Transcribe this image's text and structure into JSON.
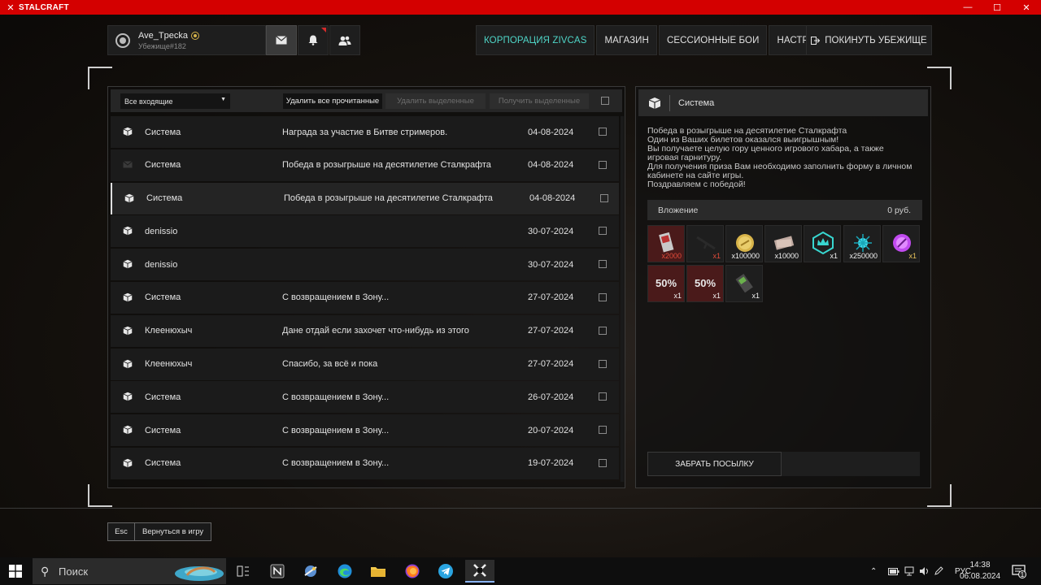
{
  "window": {
    "title": "STALCRAFT"
  },
  "profile": {
    "username": "Ave_Tpecka",
    "shelter": "Убежище#182"
  },
  "nav": {
    "items": [
      "КОРПОРАЦИЯ ZIVCAS",
      "МАГАЗИН",
      "СЕССИОННЫЕ БОИ",
      "НАСТРОЙКИ"
    ],
    "leave": "ПОКИНУТЬ УБЕЖИЩЕ"
  },
  "toolbar": {
    "filter": "Все входящие",
    "delete_read": "Удалить все прочитанные",
    "delete_selected": "Удалить выделенные",
    "get_selected": "Получить выделенные"
  },
  "messages": [
    {
      "sender": "Система",
      "subject": "Награда за участие в Битве стримеров.",
      "date": "04-08-2024",
      "icon": "box-icon"
    },
    {
      "sender": "Система",
      "subject": "Победа в розыгрыше на десятилетие Сталкрафта",
      "date": "04-08-2024",
      "icon": "envelope-icon"
    },
    {
      "sender": "Система",
      "subject": "Победа в розыгрыше на десятилетие Сталкрафта",
      "date": "04-08-2024",
      "icon": "box-icon",
      "selected": true
    },
    {
      "sender": "denissio",
      "subject": "",
      "date": "30-07-2024",
      "icon": "box-icon"
    },
    {
      "sender": "denissio",
      "subject": "",
      "date": "30-07-2024",
      "icon": "box-icon"
    },
    {
      "sender": "Система",
      "subject": "С возвращением в Зону...",
      "date": "27-07-2024",
      "icon": "box-icon"
    },
    {
      "sender": "Клеенюхыч",
      "subject": "Дане отдай если захочет что-нибудь из этого",
      "date": "27-07-2024",
      "icon": "box-icon"
    },
    {
      "sender": "Клеенюхыч",
      "subject": "Спасибо, за всё и пока",
      "date": "27-07-2024",
      "icon": "box-icon"
    },
    {
      "sender": "Система",
      "subject": "С возвращением в Зону...",
      "date": "26-07-2024",
      "icon": "box-icon"
    },
    {
      "sender": "Система",
      "subject": "С возвращением в Зону...",
      "date": "20-07-2024",
      "icon": "box-icon"
    },
    {
      "sender": "Система",
      "subject": "С возвращением в Зону...",
      "date": "19-07-2024",
      "icon": "box-icon"
    }
  ],
  "detail": {
    "sender": "Система",
    "body": [
      "Победа в розыгрыше на десятилетие Сталкрафта",
      "Один из Ваших билетов оказался выигрышным!",
      "Вы получаете целую гору ценного игрового хабара, а также игровая гарнитуру.",
      "Для получения приза Вам необходимо заполнить форму в личном кабинете на сайте игры.",
      "Поздравляем с победой!"
    ],
    "attachment_label": "Вложение",
    "attachment_amount": "0 руб.",
    "items": [
      {
        "qty": "x2000",
        "icon": "ticket-icon",
        "qty_color": "red"
      },
      {
        "qty": "x1",
        "icon": "rifle-icon",
        "qty_color": "red"
      },
      {
        "qty": "x100000",
        "icon": "coin-icon"
      },
      {
        "qty": "x10000",
        "icon": "money-icon"
      },
      {
        "qty": "x1",
        "icon": "crown-icon"
      },
      {
        "qty": "x250000",
        "icon": "spark-icon"
      },
      {
        "qty": "x1",
        "icon": "orb-icon",
        "qty_color": "gold"
      },
      {
        "qty": "x1",
        "icon": "discount-icon",
        "label": "50%"
      },
      {
        "qty": "x1",
        "icon": "discount-icon",
        "label": "50%"
      },
      {
        "qty": "x1",
        "icon": "device-icon"
      }
    ],
    "claim": "ЗАБРАТЬ ПОСЫЛКУ"
  },
  "esc": {
    "key": "Esc",
    "label": "Вернуться в игру"
  },
  "taskbar": {
    "search": "Поиск",
    "lang": "РУС",
    "time": "14:38",
    "date": "06.08.2024",
    "notif_count": "1"
  }
}
